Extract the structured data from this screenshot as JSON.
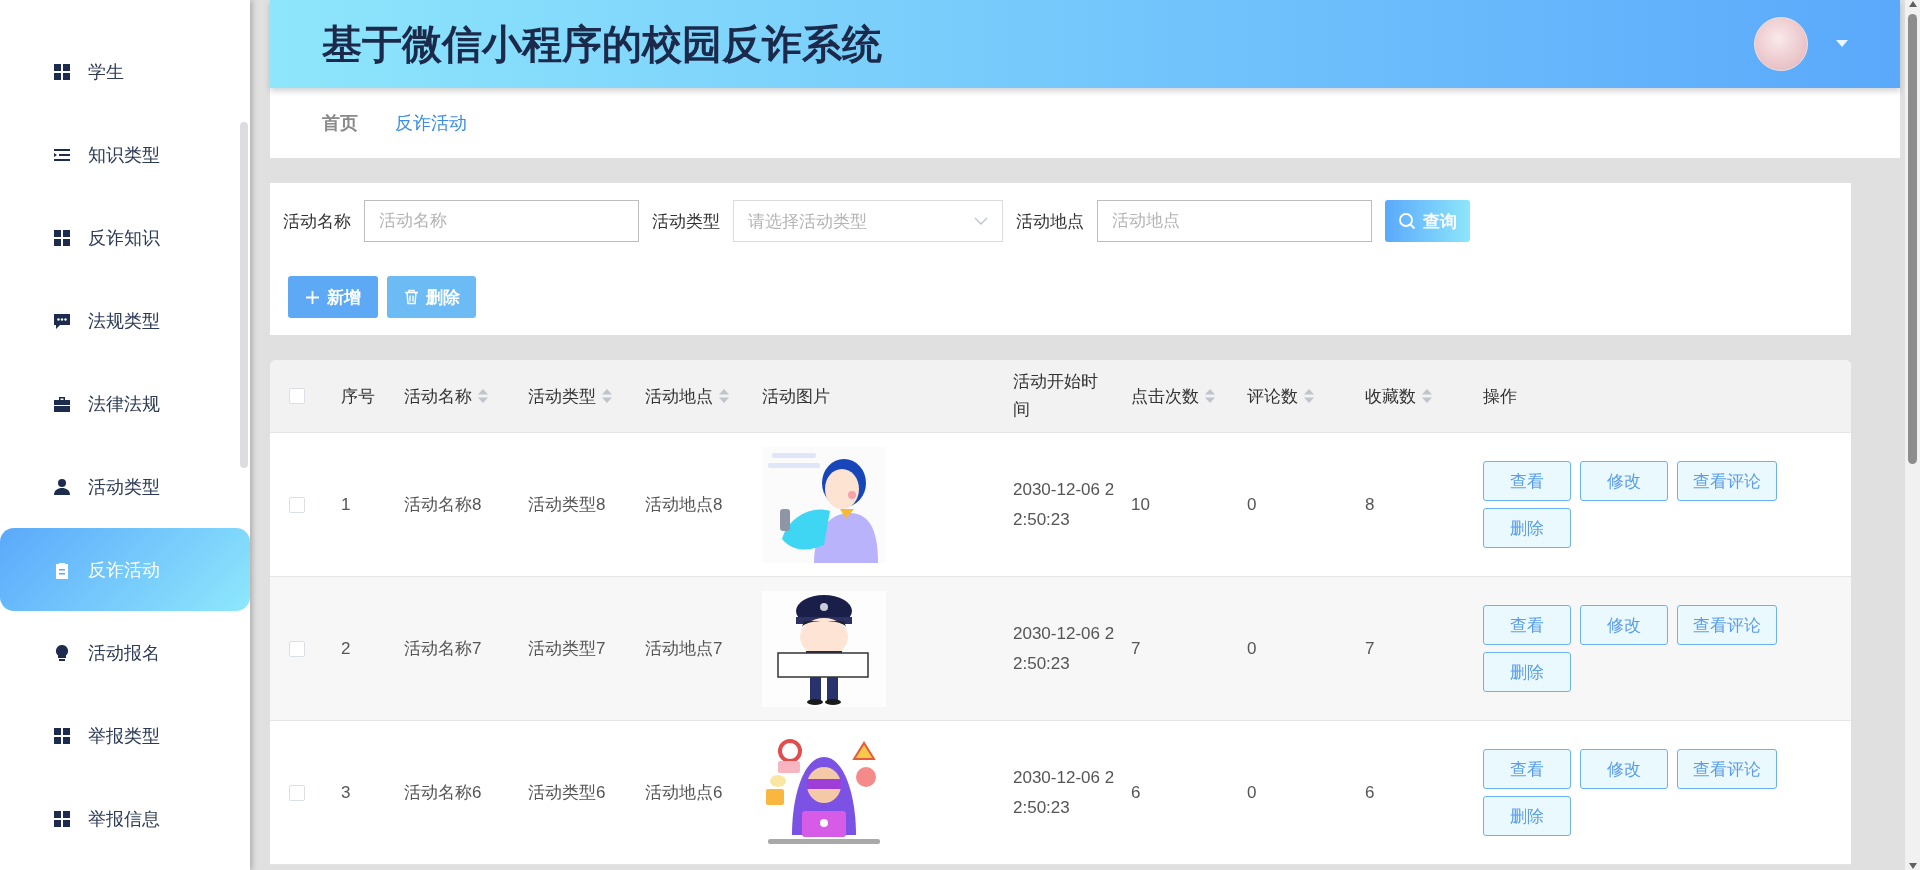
{
  "app": {
    "title": "基于微信小程序的校园反诈系统"
  },
  "sidebar": {
    "items": [
      {
        "label": "学生",
        "selected": false
      },
      {
        "label": "知识类型",
        "selected": false
      },
      {
        "label": "反诈知识",
        "selected": false
      },
      {
        "label": "法规类型",
        "selected": false
      },
      {
        "label": "法律法规",
        "selected": false
      },
      {
        "label": "活动类型",
        "selected": false
      },
      {
        "label": "反诈活动",
        "selected": true
      },
      {
        "label": "活动报名",
        "selected": false
      },
      {
        "label": "举报类型",
        "selected": false
      },
      {
        "label": "举报信息",
        "selected": false
      }
    ]
  },
  "breadcrumb": [
    {
      "label": "首页",
      "current": false
    },
    {
      "label": "反诈活动",
      "current": true
    }
  ],
  "filters": [
    {
      "label": "活动名称",
      "kind": "input",
      "placeholder": "活动名称"
    },
    {
      "label": "活动类型",
      "kind": "select",
      "placeholder": "请选择活动类型"
    },
    {
      "label": "活动地点",
      "kind": "input",
      "placeholder": "活动地点"
    }
  ],
  "search_button": "查询",
  "actions": [
    {
      "label": "新增",
      "kind": "add"
    },
    {
      "label": "删除",
      "kind": "delete"
    }
  ],
  "table": {
    "select_all": {
      "checked": false
    },
    "columns": [
      {
        "label": "序号",
        "sortable": false
      },
      {
        "label": "活动名称",
        "sortable": true
      },
      {
        "label": "活动类型",
        "sortable": true
      },
      {
        "label": "活动地点",
        "sortable": true
      },
      {
        "label": "活动图片",
        "sortable": false
      },
      {
        "label": "活动开始时间",
        "sortable": false
      },
      {
        "label": "点击次数",
        "sortable": true
      },
      {
        "label": "评论数",
        "sortable": true
      },
      {
        "label": "收藏数",
        "sortable": true
      },
      {
        "label": "操作",
        "sortable": false
      }
    ],
    "rows": [
      {
        "checked": false,
        "index": "1",
        "name": "活动名称8",
        "type": "活动类型8",
        "place": "活动地点8",
        "start_time": "2030-12-06 22:50:23",
        "clicks": "10",
        "comments": "0",
        "favorites": "8",
        "actions": [
          "查看",
          "修改",
          "查看评论",
          "删除"
        ]
      },
      {
        "checked": false,
        "index": "2",
        "name": "活动名称7",
        "type": "活动类型7",
        "place": "活动地点7",
        "start_time": "2030-12-06 22:50:23",
        "clicks": "7",
        "comments": "0",
        "favorites": "7",
        "actions": [
          "查看",
          "修改",
          "查看评论",
          "删除"
        ]
      },
      {
        "checked": false,
        "index": "3",
        "name": "活动名称6",
        "type": "活动类型6",
        "place": "活动地点6",
        "start_time": "2030-12-06 22:50:23",
        "clicks": "6",
        "comments": "0",
        "favorites": "6",
        "actions": [
          "查看",
          "修改",
          "查看评论",
          "删除"
        ]
      }
    ]
  }
}
